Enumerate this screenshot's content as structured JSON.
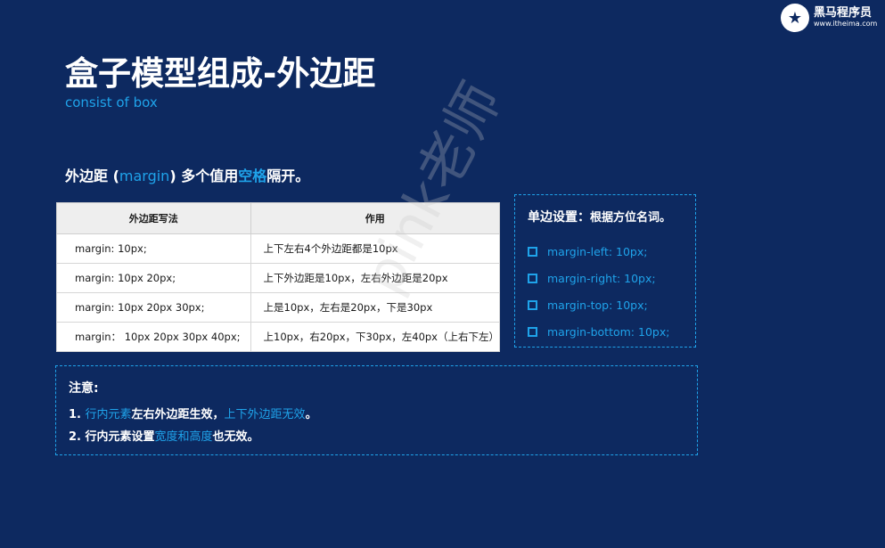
{
  "logo": {
    "mark": "★",
    "name": "黑马程序员",
    "url": "www.itheima.com"
  },
  "title": "盒子模型组成-外边距",
  "subtitle": "consist of box",
  "lead": {
    "part1": "外边距 (",
    "keyword": "margin",
    "part2": ") 多个值用",
    "highlight": "空格",
    "part3": "隔开。"
  },
  "table": {
    "headers": [
      "外边距写法",
      "作用"
    ],
    "rows": [
      [
        "margin: 10px;",
        "上下左右4个外边距都是10px"
      ],
      [
        "margin: 10px 20px;",
        "上下外边距是10px，左右外边距是20px"
      ],
      [
        "margin: 10px 20px 30px;",
        "上是10px，左右是20px，下是30px"
      ],
      [
        "margin： 10px 20px 30px 40px;",
        "上10px，右20px，下30px，左40px（上右下左）"
      ]
    ]
  },
  "side": {
    "heading": "单边设置：",
    "heading_sub": "根据方位名词。",
    "items": [
      "margin-left: 10px;",
      "margin-right: 10px;",
      "margin-top: 10px;",
      "margin-bottom: 10px;"
    ]
  },
  "note": {
    "title": "注意:",
    "line1": {
      "prefix": "1. ",
      "blue1": "行内元素",
      "mid": "左右外边距生效，",
      "blue2": "上下外边距无效",
      "end": "。"
    },
    "line2": {
      "prefix": "2. 行内元素设置",
      "blue": "宽度和高度",
      "end": "也无效。"
    }
  },
  "watermark": "pink老师"
}
